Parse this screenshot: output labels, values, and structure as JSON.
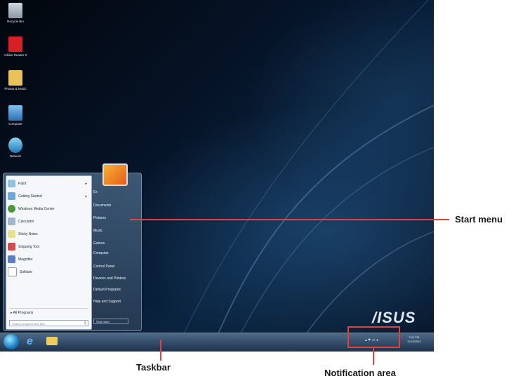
{
  "desktop": {
    "icons": [
      {
        "label": "Recycle Bin",
        "icon": "recycle-bin-icon"
      },
      {
        "label": "Adobe Reader X",
        "icon": "adobe-reader-icon"
      },
      {
        "label": "Photos & Music",
        "icon": "folder-icon"
      },
      {
        "label": "Computer",
        "icon": "computer-icon"
      },
      {
        "label": "Network",
        "icon": "network-icon"
      }
    ],
    "brand_logo": "/ISUS"
  },
  "start_menu": {
    "programs": [
      {
        "label": "Paint",
        "has_arrow": true
      },
      {
        "label": "Getting Started",
        "has_arrow": true
      },
      {
        "label": "Windows Media Center",
        "has_arrow": false
      },
      {
        "label": "Calculator",
        "has_arrow": false
      },
      {
        "label": "Sticky Notes",
        "has_arrow": false
      },
      {
        "label": "Snipping Tool",
        "has_arrow": false
      },
      {
        "label": "Magnifier",
        "has_arrow": false
      },
      {
        "label": "Solitaire",
        "has_arrow": false
      }
    ],
    "all_programs": "All Programs",
    "search_placeholder": "Search programs and files",
    "right_items": [
      "Ex",
      "Documents",
      "Pictures",
      "Music",
      "Games",
      "Computer",
      "Control Panel",
      "Devices and Printers",
      "Default Programs",
      "Help and Support"
    ],
    "shutdown_label": "Shut down",
    "arrow_glyph": "▸"
  },
  "taskbar": {
    "clock_time": "3:01 PM",
    "clock_date": "11/18/2010",
    "tray_glyphs": "▴  ⚑  ▭  ◂"
  },
  "annotations": {
    "start_menu": "Start menu",
    "taskbar": "Taskbar",
    "notification_area": "Notification area"
  },
  "colors": {
    "callout_line": "#e5403a"
  }
}
